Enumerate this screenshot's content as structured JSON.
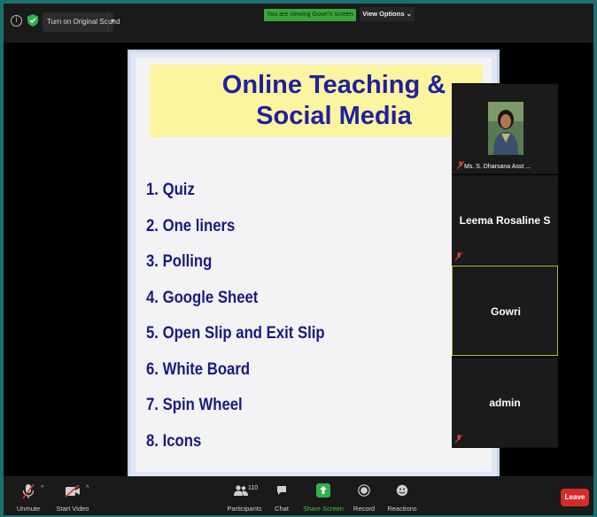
{
  "topbar": {
    "original_sound_label": "Turn on Original Sound",
    "viewing_badge": "You are viewing Gowri's screen",
    "view_options_label": "View Options ⌄"
  },
  "slide": {
    "title_line1": "Online Teaching &",
    "title_line2": "Social Media",
    "items": [
      "1. Quiz",
      "2. One liners",
      "3. Polling",
      "4. Google Sheet",
      "5. Open Slip and Exit Slip",
      "6. White Board",
      "7. Spin Wheel",
      "8. Icons"
    ]
  },
  "participants": [
    {
      "name": "Ms. S. Dharsana Asst ...",
      "video": true
    },
    {
      "name": "Leema Rosaline S",
      "video": false
    },
    {
      "name": "Gowri",
      "video": false,
      "active": true
    },
    {
      "name": "admin",
      "video": false
    }
  ],
  "toolbar": {
    "unmute_label": "Unmute",
    "start_video_label": "Start Video",
    "participants_label": "Participants",
    "participants_count": "110",
    "chat_label": "Chat",
    "share_screen_label": "Share Screen",
    "record_label": "Record",
    "reactions_label": "Reactions",
    "leave_label": "Leave"
  },
  "colors": {
    "accent_green": "#3aa63a",
    "leave_red": "#d52b2b",
    "slide_title_bg": "#fbf5a0",
    "slide_text": "#1a1a80"
  }
}
